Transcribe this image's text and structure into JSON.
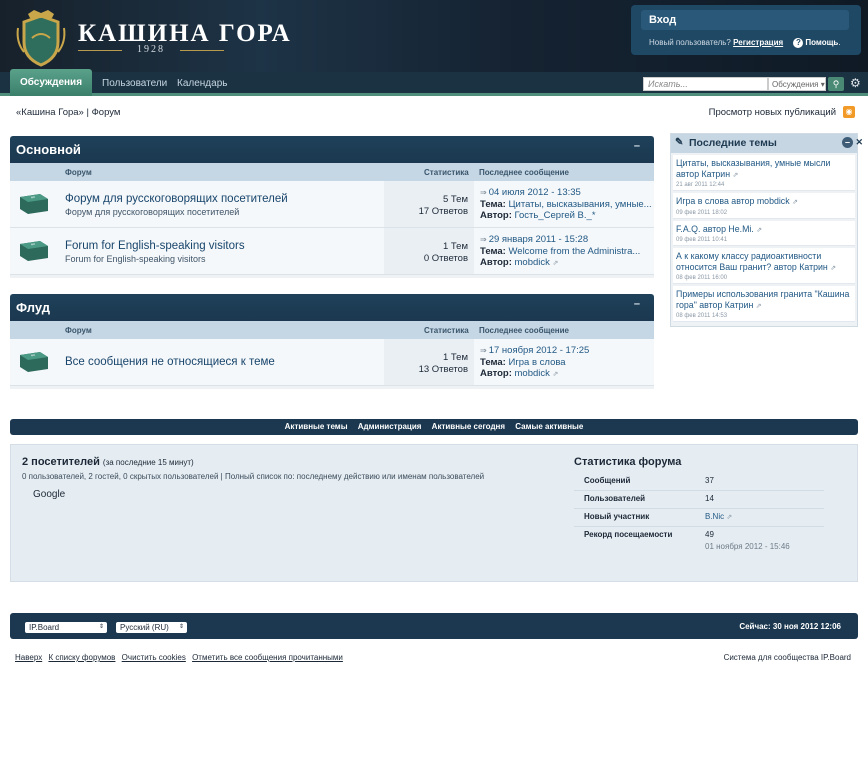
{
  "header": {
    "logo_title": "КАШИНА ГОРА",
    "logo_year": "1928",
    "login_label": "Вход",
    "new_user_text": "Новый пользователь?",
    "register_label": "Регистрация",
    "help_label": "Помощь"
  },
  "nav": {
    "tabs": [
      {
        "label": "Обсуждения",
        "active": true
      },
      {
        "label": "Пользователи",
        "active": false
      },
      {
        "label": "Календарь",
        "active": false
      }
    ],
    "search_placeholder": "Искать...",
    "search_scope": "Обсуждения"
  },
  "breadcrumb": "«Кашина Гора» | Форум",
  "new_content_label": "Просмотр новых публикаций",
  "categories": [
    {
      "title": "Основной",
      "col_forum": "Форум",
      "col_stats": "Статистика",
      "col_last": "Последнее сообщение",
      "forums": [
        {
          "name": "Форум для русскоговорящих посетителей",
          "desc": "Форум для русскоговорящих посетителей",
          "topics": "5 Тем",
          "replies": "17 Ответов",
          "last_date": "04 июля 2012 - 13:35",
          "last_topic_label": "Тема:",
          "last_topic": "Цитаты, высказывания, умные...",
          "last_author_label": "Автор:",
          "last_author": "Гость_Сергей В._*"
        },
        {
          "name": "Forum for English-speaking visitors",
          "desc": "Forum for English-speaking visitors",
          "topics": "1 Тем",
          "replies": "0 Ответов",
          "last_date": "29 января 2011 - 15:28",
          "last_topic_label": "Тема:",
          "last_topic": "Welcome from the Administra...",
          "last_author_label": "Автор:",
          "last_author": "mobdick"
        }
      ]
    },
    {
      "title": "Флуд",
      "col_forum": "Форум",
      "col_stats": "Статистика",
      "col_last": "Последнее сообщение",
      "forums": [
        {
          "name": "Все сообщения не относящиеся к теме",
          "desc": "",
          "topics": "1 Тем",
          "replies": "13 Ответов",
          "last_date": "17 ноября 2012 - 17:25",
          "last_topic_label": "Тема:",
          "last_topic": "Игра в слова",
          "last_author_label": "Автор:",
          "last_author": "mobdick"
        }
      ]
    }
  ],
  "sidebar": {
    "title": "Последние темы",
    "items": [
      {
        "title": "Цитаты, высказывания, умные мысли автор Катрин",
        "date": "21 авг 2011 12:44"
      },
      {
        "title": "Игра в слова автор mobdick",
        "date": "09 фев 2011 18:02"
      },
      {
        "title": "F.A.Q. автор He.Mi.",
        "date": "09 фев 2011 10:41"
      },
      {
        "title": "А к какому классу радиоактивности относится Ваш гранит? автор Катрин",
        "date": "08 фев 2011 16:00"
      },
      {
        "title": "Примеры использования гранита \"Кашина гора\" автор Катрин",
        "date": "08 фев 2011 14:53"
      }
    ]
  },
  "active_bar": [
    "Активные темы",
    "Администрация",
    "Активные сегодня",
    "Самые активные"
  ],
  "visitors": {
    "count": "2 посетителей",
    "period": "(за последние 15 минут)",
    "detail": "0 пользователей, 2 гостей, 0 скрытых пользователей | Полный список по: последнему действию или именам пользователей",
    "names": "Google"
  },
  "forum_stats": {
    "title": "Статистика форума",
    "rows": [
      {
        "label": "Сообщений",
        "value": "37"
      },
      {
        "label": "Пользователей",
        "value": "14"
      },
      {
        "label": "Новый участник",
        "value": "B.Nic"
      },
      {
        "label": "Рекорд посещаемости",
        "value": "49"
      }
    ],
    "record_date": "01 ноября 2012 - 15:46"
  },
  "footer": {
    "skin_select": "IP.Board",
    "lang_select": "Русский (RU)",
    "current_time": "Сейчас: 30 ноя 2012 12:06",
    "links": [
      "Наверх",
      "К списку форумов",
      "Очистить cookies",
      "Отметить все сообщения прочитанными"
    ],
    "powered_by": "Система для сообщества IP.Board"
  },
  "colors": {
    "header_dark": "#17212b",
    "category_head": "#1b3850",
    "accent_green": "#4f8e7b",
    "link_blue": "#225985"
  }
}
